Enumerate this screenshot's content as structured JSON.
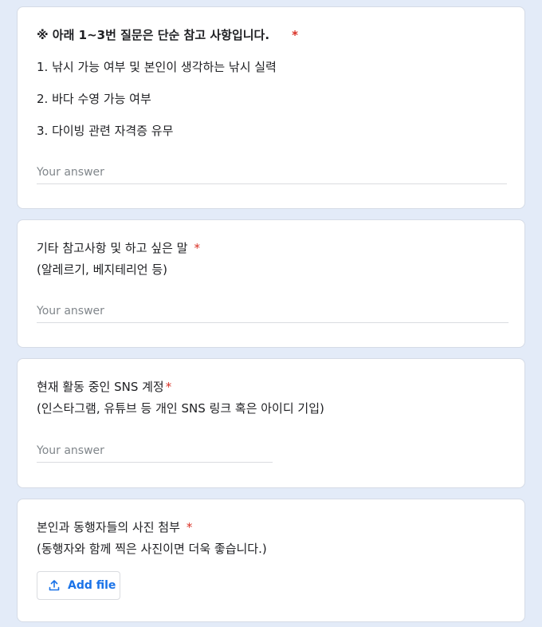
{
  "questions": [
    {
      "title": "※ 아래 1~3번 질문은 단순 참고 사항입니다.",
      "required_mark": "*",
      "lines": [
        "1. 낚시 가능 여부 및 본인이 생각하는 낚시 실력",
        "2. 바다 수영 가능 여부",
        "3. 다이빙 관련 자격증 유무"
      ],
      "placeholder": "Your answer"
    },
    {
      "title": "기타 참고사항 및 하고 싶은 말",
      "required_mark": "*",
      "subtitle": "(알레르기, 베지테리언 등)",
      "placeholder": "Your answer"
    },
    {
      "title": "현재 활동 중인 SNS 계정",
      "required_mark": "*",
      "subtitle": " (인스타그램, 유튜브 등 개인 SNS 링크 혹은 아이디 기입)",
      "placeholder": "Your answer"
    },
    {
      "title": "본인과 동행자들의 사진 첨부",
      "required_mark": "*",
      "subtitle": "(동행자와 함께 찍은 사진이면 더욱 좋습니다.)",
      "button_label": "Add file",
      "button_icon": "upload-icon"
    }
  ],
  "colors": {
    "background": "#e3ebf8",
    "required": "#d93025",
    "accent": "#1a73e8"
  }
}
